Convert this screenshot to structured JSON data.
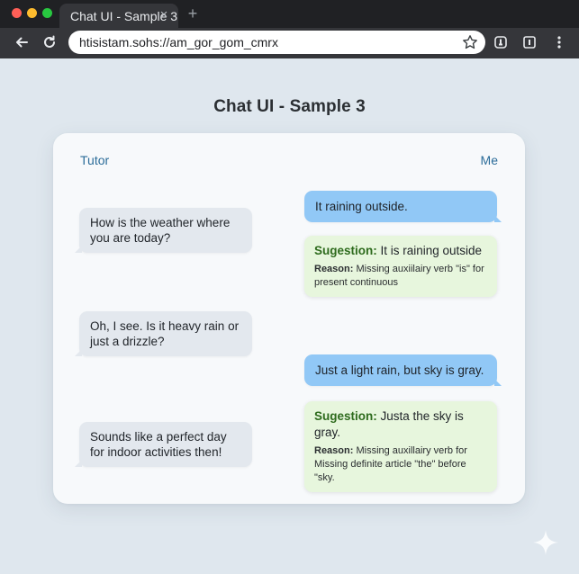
{
  "browser": {
    "tab_title": "Chat UI - Sample 3",
    "tab_close": "×",
    "new_tab": "+",
    "url": "htisistam.sohs://am_gor_gom_cmrx"
  },
  "page": {
    "title": "Chat UI - Sample 3"
  },
  "chat": {
    "left_label": "Tutor",
    "right_label": "Me",
    "tutor_messages": [
      "How is the weather where you are today?",
      "Oh, I see. Is it heavy rain or just a drizzle?",
      "Sounds like a perfect day for indoor activities then!"
    ],
    "my_messages": [
      "It raining outside.",
      "Just a light rain, but sky is gray."
    ],
    "suggestions": [
      {
        "label": "Sugestion:",
        "text": " It is raining outside",
        "reason_label": "Reason:",
        "reason": " Missing auxiilairy verb \"is\" for present continuous"
      },
      {
        "label": "Sugestion:",
        "text": " Justa the sky is gray.",
        "reason_label": "Reason:",
        "reason": " Missing auxillairy verb for Missing definite article \"the\" before \"sky."
      }
    ]
  },
  "colors": {
    "page_bg": "#dfe7ee",
    "tutor_bubble": "#e3e8ee",
    "my_bubble": "#91c8f6",
    "suggestion_bubble": "#e7f6dd",
    "accent_label": "#2b6c99",
    "suggestion_key": "#2e6b1d"
  },
  "icons": [
    "back-icon",
    "reload-icon",
    "star-icon",
    "extension-icon",
    "menu-icon",
    "sparkle-icon"
  ]
}
